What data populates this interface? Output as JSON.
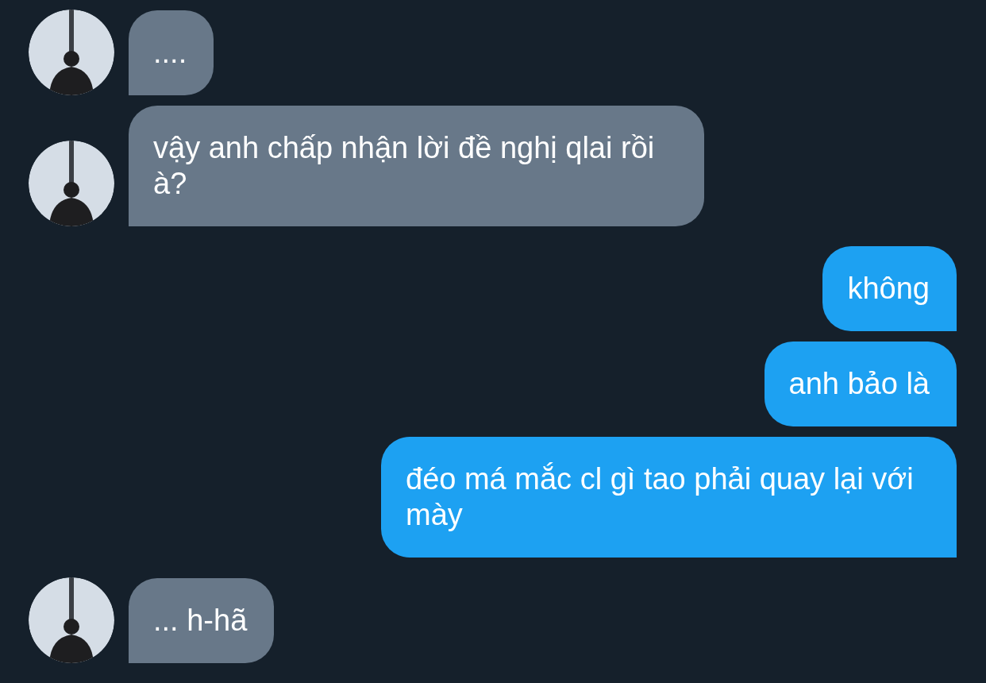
{
  "messages": [
    {
      "kind": "incoming",
      "text": "...."
    },
    {
      "kind": "incoming",
      "text": "vậy anh chấp nhận lời đề nghị qlai rồi à?"
    },
    {
      "kind": "outgoing",
      "text": "không"
    },
    {
      "kind": "outgoing",
      "text": "anh bảo là"
    },
    {
      "kind": "outgoing",
      "text": "đéo má mắc cl gì tao phải quay lại với mày"
    },
    {
      "kind": "incoming",
      "text": "... h-hã"
    }
  ]
}
